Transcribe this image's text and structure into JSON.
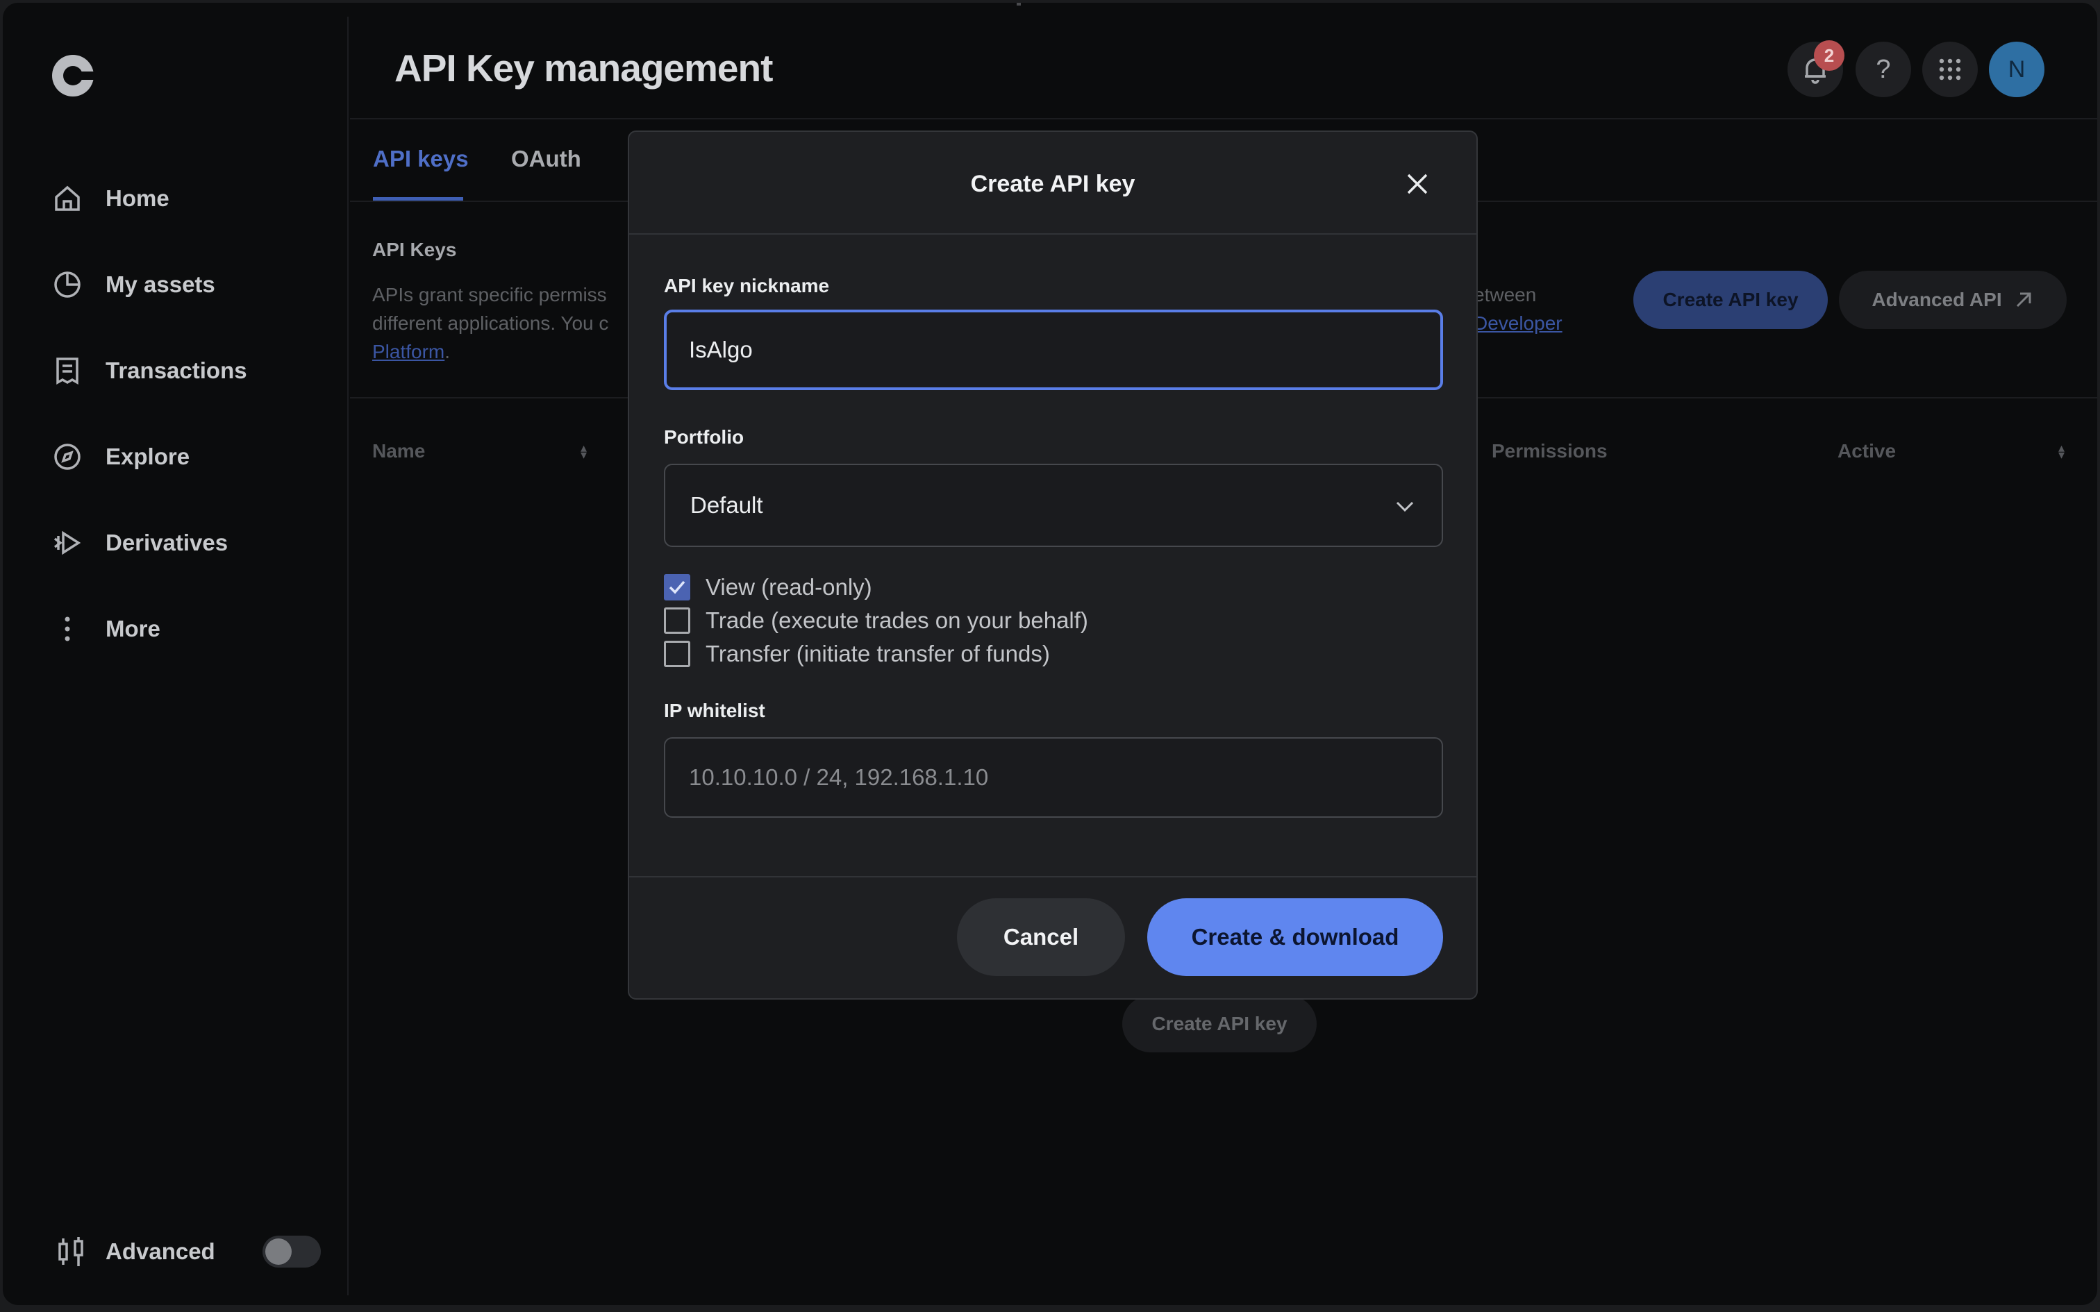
{
  "header": {
    "title": "API Key management",
    "notification_count": "2",
    "help_label": "?",
    "avatar_initial": "N"
  },
  "sidebar": {
    "items": [
      {
        "label": "Home",
        "icon": "home-icon"
      },
      {
        "label": "My assets",
        "icon": "pie-chart-icon"
      },
      {
        "label": "Transactions",
        "icon": "receipt-icon"
      },
      {
        "label": "Explore",
        "icon": "compass-icon"
      },
      {
        "label": "Derivatives",
        "icon": "derivatives-icon"
      },
      {
        "label": "More",
        "icon": "more-vertical-icon"
      }
    ],
    "advanced_label": "Advanced",
    "advanced_enabled": false
  },
  "tabs": [
    {
      "label": "API keys",
      "active": true
    },
    {
      "label": "OAuth",
      "active": false
    }
  ],
  "section": {
    "title": "API Keys",
    "desc_line1": "APIs grant specific permiss",
    "desc_line2": "different applications. You c",
    "desc_link": "Platform",
    "desc_suffix": ".",
    "desc_right_line1": "etween",
    "desc_right_link": "Developer"
  },
  "actions": {
    "create_label": "Create API key",
    "advanced_api_label": "Advanced API"
  },
  "table": {
    "columns": [
      "Name",
      "Permissions",
      "Active"
    ]
  },
  "empty_state": {
    "create_label": "Create API key"
  },
  "modal": {
    "title": "Create API key",
    "nickname_label": "API key nickname",
    "nickname_value": "IsAlgo",
    "portfolio_label": "Portfolio",
    "portfolio_value": "Default",
    "permissions": [
      {
        "label": "View (read-only)",
        "checked": true
      },
      {
        "label": "Trade (execute trades on your behalf)",
        "checked": false
      },
      {
        "label": "Transfer (initiate transfer of funds)",
        "checked": false
      }
    ],
    "ip_label": "IP whitelist",
    "ip_placeholder": "10.10.10.0 / 24, 192.168.1.10",
    "cancel_label": "Cancel",
    "submit_label": "Create & download"
  },
  "colors": {
    "accent": "#5f86ef",
    "background": "#0b0c0d",
    "modal": "#1e1f22",
    "badge": "#b84e50"
  }
}
